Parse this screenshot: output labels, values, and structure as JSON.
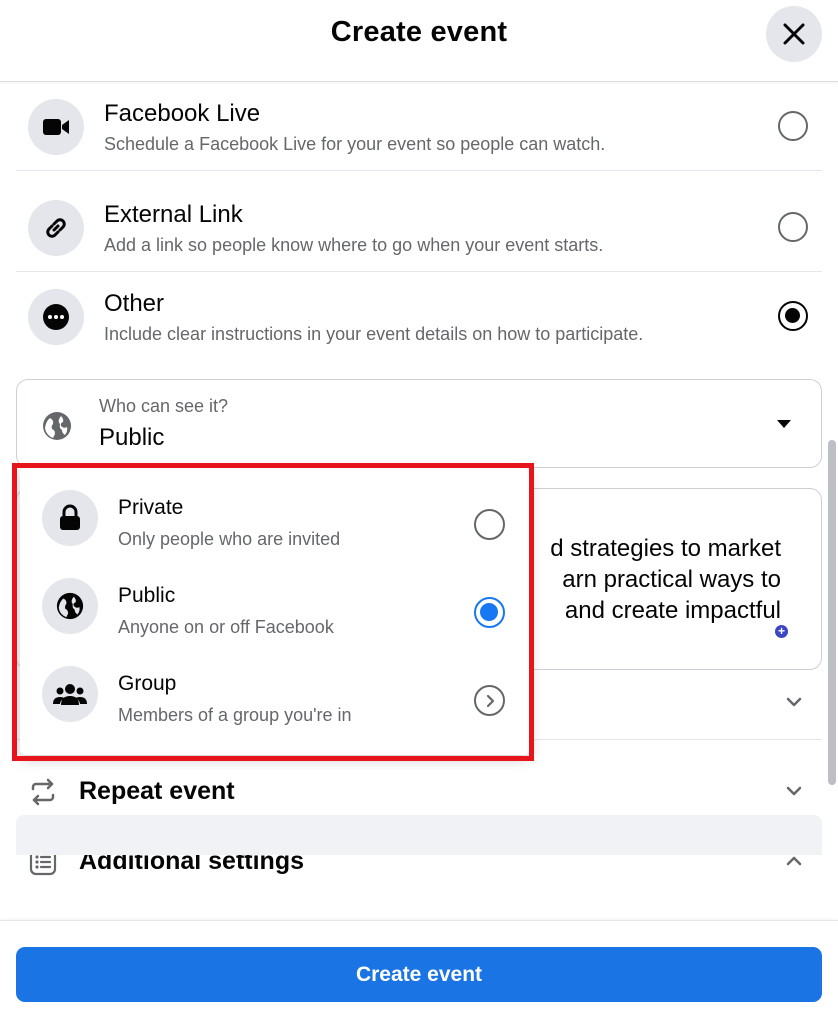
{
  "header": {
    "title": "Create event",
    "close_icon": "close-icon"
  },
  "location_options": [
    {
      "title": "Facebook Live",
      "subtitle": "Schedule a Facebook Live for your event so people can watch.",
      "icon": "video-camera-icon",
      "selected": false
    },
    {
      "title": "External Link",
      "subtitle": "Add a link so people know where to go when your event starts.",
      "icon": "link-icon",
      "selected": false
    },
    {
      "title": "Other",
      "subtitle": "Include clear instructions in your event details on how to participate.",
      "icon": "more-icon",
      "selected": true
    }
  ],
  "privacy": {
    "label": "Who can see it?",
    "value": "Public",
    "icon": "globe-icon"
  },
  "details_text": {
    "line1": "d strategies to market",
    "line2": "arn practical ways to",
    "line3": " and create impactful"
  },
  "privacy_menu": [
    {
      "title": "Private",
      "subtitle": "Only people who are invited",
      "icon": "lock-icon",
      "control": "radio",
      "selected": false
    },
    {
      "title": "Public",
      "subtitle": "Anyone on or off Facebook",
      "icon": "globe-icon",
      "control": "radio",
      "selected": true
    },
    {
      "title": "Group",
      "subtitle": "Members of a group you're in",
      "icon": "group-icon",
      "control": "arrow",
      "selected": false
    }
  ],
  "sections": {
    "repeat_event": "Repeat event",
    "additional_settings": "Additional settings"
  },
  "footer": {
    "button_label": "Create event"
  },
  "colors": {
    "accent": "#1b74e4",
    "highlight_frame": "#e8141c",
    "icon_bg": "#e4e6eb"
  }
}
